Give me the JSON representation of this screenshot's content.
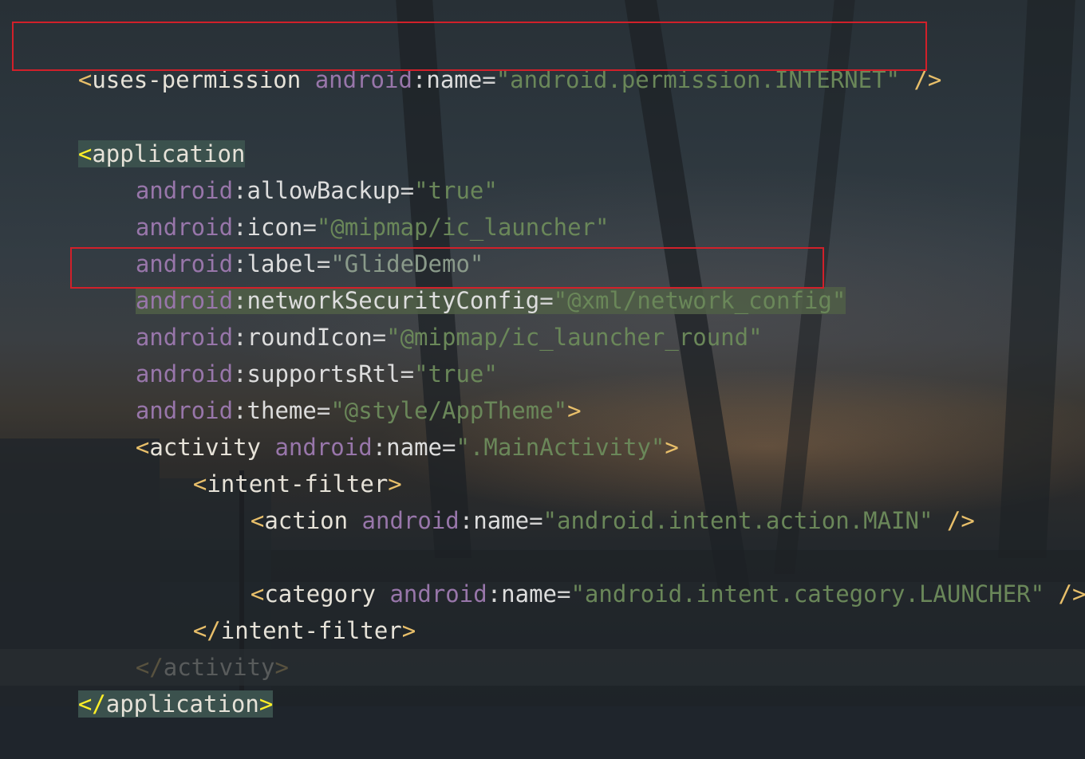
{
  "editor": {
    "language": "xml",
    "lines": [
      {
        "id": "uses-permission",
        "open": "<",
        "tag": "uses-permission",
        "attr_ns": "android",
        "colon": ":",
        "attr": "name",
        "eq": "=",
        "value": "\"android.permission.INTERNET\"",
        "close": " />"
      },
      {
        "id": "application-open",
        "open": "<",
        "tag": "application"
      },
      {
        "id": "allowBackup",
        "attr_ns": "android",
        "colon": ":",
        "attr": "allowBackup",
        "eq": "=",
        "value": "\"true\""
      },
      {
        "id": "icon",
        "attr_ns": "android",
        "colon": ":",
        "attr": "icon",
        "eq": "=",
        "value": "\"@mipmap/ic_launcher\""
      },
      {
        "id": "label",
        "attr_ns": "android",
        "colon": ":",
        "attr": "label",
        "eq": "=",
        "value": "\"GlideDemo\""
      },
      {
        "id": "networkSecurityConfig",
        "attr_ns": "android",
        "colon": ":",
        "attr": "networkSecurityConfig",
        "eq": "=",
        "value": "\"@xml/network_config\""
      },
      {
        "id": "roundIcon",
        "attr_ns": "android",
        "colon": ":",
        "attr": "roundIcon",
        "eq": "=",
        "value": "\"@mipmap/ic_launcher_round\""
      },
      {
        "id": "supportsRtl",
        "attr_ns": "android",
        "colon": ":",
        "attr": "supportsRtl",
        "eq": "=",
        "value": "\"true\""
      },
      {
        "id": "theme",
        "attr_ns": "android",
        "colon": ":",
        "attr": "theme",
        "eq": "=",
        "value": "\"@style/AppTheme\"",
        "close": ">"
      },
      {
        "id": "activity-open",
        "open": "<",
        "tag": "activity",
        "attr_ns": "android",
        "colon": ":",
        "attr": "name",
        "eq": "=",
        "value": "\".MainActivity\"",
        "close": ">"
      },
      {
        "id": "intent-filter-open",
        "open": "<",
        "tag": "intent-filter",
        "close": ">"
      },
      {
        "id": "action",
        "open": "<",
        "tag": "action",
        "attr_ns": "android",
        "colon": ":",
        "attr": "name",
        "eq": "=",
        "value": "\"android.intent.action.MAIN\"",
        "close": " />"
      },
      {
        "id": "category",
        "open": "<",
        "tag": "category",
        "attr_ns": "android",
        "colon": ":",
        "attr": "name",
        "eq": "=",
        "value": "\"android.intent.category.LAUNCHER\"",
        "close": " />"
      },
      {
        "id": "intent-filter-close",
        "open": "</",
        "tag": "intent-filter",
        "close": ">"
      },
      {
        "id": "activity-close",
        "open": "</",
        "tag": "activity",
        "close": ">"
      },
      {
        "id": "application-close",
        "open": "</",
        "tag": "application",
        "close": ">"
      }
    ]
  },
  "annotations": {
    "box_color": "#d1202a",
    "boxed_lines": [
      "uses-permission",
      "networkSecurityConfig"
    ]
  },
  "colors": {
    "tag_bracket": "#e8bf6a",
    "attribute_namespace": "#9876aa",
    "string_value": "#6a8759",
    "matched_bracket": "#ffef28"
  }
}
